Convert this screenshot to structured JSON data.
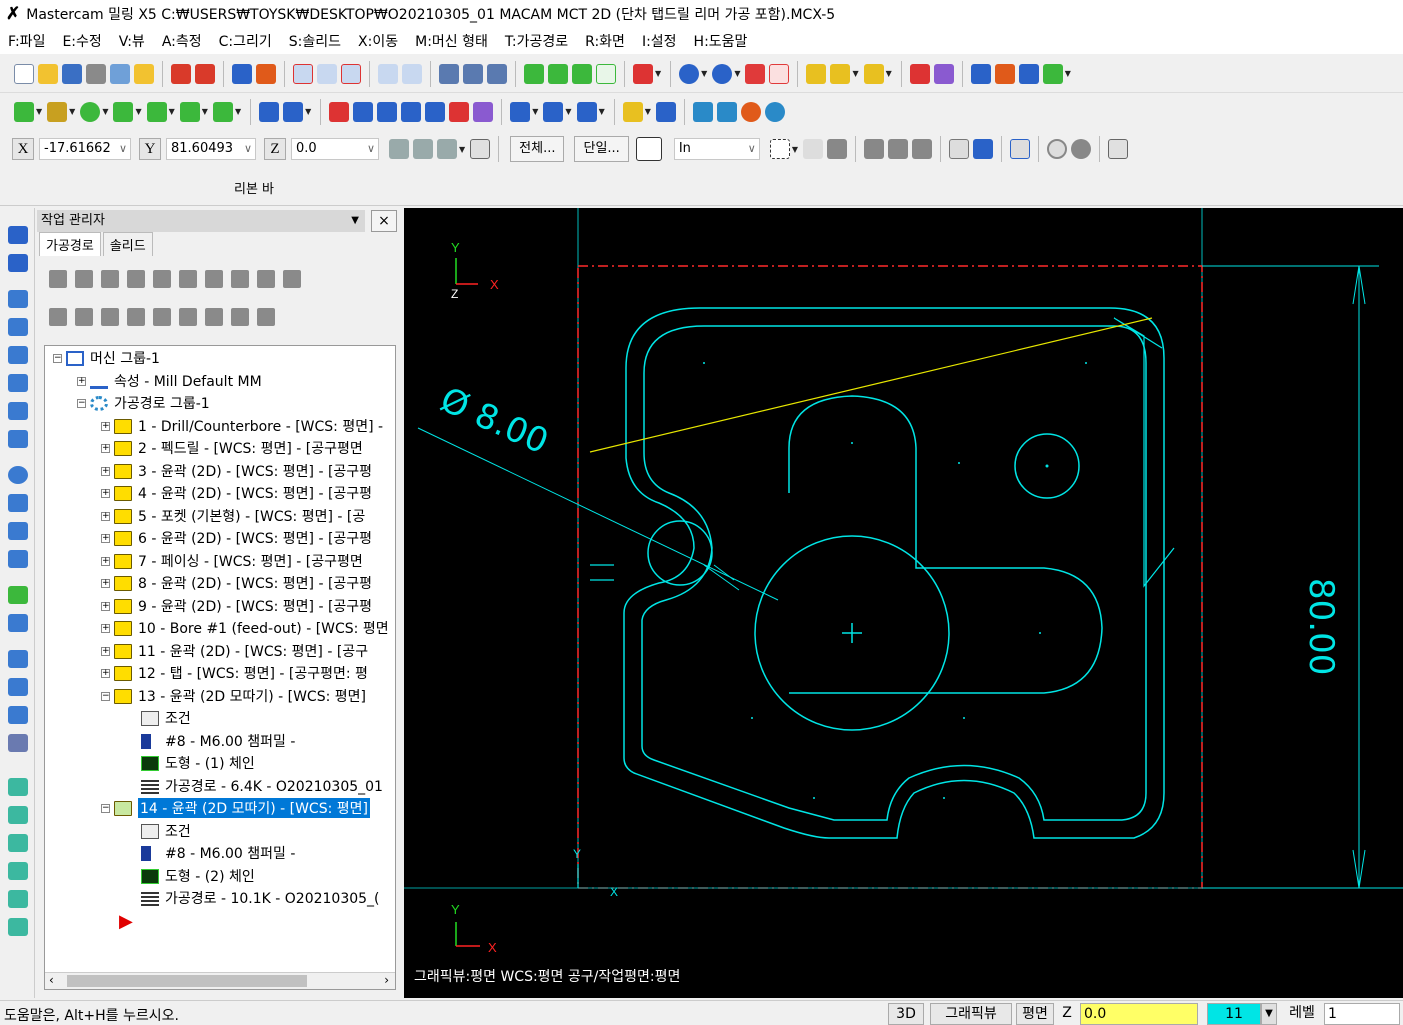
{
  "window": {
    "title": "Mastercam 밀링 X5  C:₩USERS₩TOYSK₩DESKTOP₩O20210305_01 MACAM MCT 2D (단차 탭드릴 리머 가공 포함).MCX-5"
  },
  "menu": [
    "F:파일",
    "E:수정",
    "V:뷰",
    "A:측정",
    "C:그리기",
    "S:솔리드",
    "X:이동",
    "M:머신 형태",
    "T:가공경로",
    "R:화면",
    "I:설정",
    "H:도움말"
  ],
  "coords": {
    "x_label": "X",
    "x_value": "-17.61662",
    "y_label": "Y",
    "y_value": "81.60493",
    "z_label": "Z",
    "z_value": "0.0",
    "all_button": "전체...",
    "single_button": "단일...",
    "units": "In"
  },
  "ribbon": {
    "label": "리본 바"
  },
  "manager": {
    "title": "작업 관리자",
    "close": "×",
    "tabs": [
      "가공경로",
      "솔리드"
    ],
    "tree": [
      {
        "label": "머신 그룹-1"
      },
      {
        "label": "속성 - Mill Default MM"
      },
      {
        "label": "가공경로 그룹-1"
      },
      {
        "label": "1 - Drill/Counterbore - [WCS: 평면] -"
      },
      {
        "label": "2 - 펙드릴 - [WCS: 평면] - [공구평면"
      },
      {
        "label": "3 - 윤곽 (2D) - [WCS: 평면] - [공구평"
      },
      {
        "label": "4 - 윤곽 (2D) - [WCS: 평면] - [공구평"
      },
      {
        "label": "5 - 포켓 (기본형) - [WCS: 평면] - [공"
      },
      {
        "label": "6 - 윤곽 (2D) - [WCS: 평면] - [공구평"
      },
      {
        "label": "7 - 페이싱 - [WCS: 평면] - [공구평면"
      },
      {
        "label": "8 - 윤곽 (2D) - [WCS: 평면] - [공구평"
      },
      {
        "label": "9 - 윤곽 (2D) - [WCS: 평면] - [공구평"
      },
      {
        "label": "10 - Bore #1 (feed-out) - [WCS: 평면"
      },
      {
        "label": "11 - 윤곽 (2D) - [WCS: 평면] - [공구"
      },
      {
        "label": "12 - 탭 - [WCS: 평면] - [공구평면: 평"
      },
      {
        "label": "13 - 윤곽 (2D 모따기) - [WCS: 평면]"
      },
      {
        "label": "조건"
      },
      {
        "label": "#8 - M6.00 챔퍼밀 -"
      },
      {
        "label": "도형 - (1) 체인"
      },
      {
        "label": "가공경로 - 6.4K - O20210305_01"
      },
      {
        "label": "14 - 윤곽 (2D 모따기) - [WCS: 평면]"
      },
      {
        "label": "조건"
      },
      {
        "label": "#8 - M6.00 챔퍼밀 -"
      },
      {
        "label": "도형 - (2) 체인"
      },
      {
        "label": "가공경로 - 10.1K - O20210305_("
      }
    ]
  },
  "graphics": {
    "axis_y": "Y",
    "axis_x": "X",
    "axis_z": "Z",
    "diameter_label": "Ø 8.00",
    "dimension_label": "80.00",
    "view_info": "그래픽뷰:평면   WCS:평면   공구/작업평면:평면",
    "colors": {
      "geometry": "#00e5e5",
      "stock": "#ff2a2a",
      "path": "#e6e600",
      "axes_y": "#22dd22",
      "axes_x": "#ff2222"
    }
  },
  "status": {
    "hint": "도움말은,  Alt+H를 누르시오.",
    "btn_3d": "3D",
    "btn_gview": "그래픽뷰",
    "btn_plane": "평면",
    "z_label": "Z",
    "z_value": "0.0",
    "color_value": "11",
    "level_label": "레벨",
    "level_value": "1"
  }
}
